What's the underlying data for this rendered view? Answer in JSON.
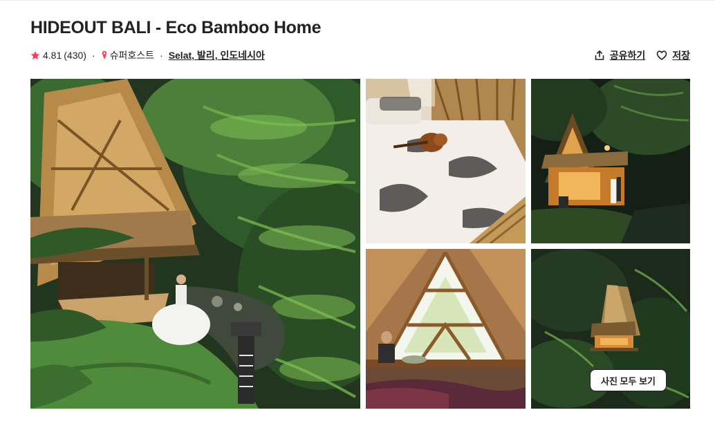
{
  "listing": {
    "title": "HIDEOUT BALI - Eco Bamboo Home",
    "rating": "4.81",
    "reviews": "(430)",
    "separator": "·",
    "host_badge": "슈퍼호스트",
    "location": "Selat, 발리, 인도네시아"
  },
  "actions": {
    "share_label": "공유하기",
    "save_label": "저장"
  },
  "gallery": {
    "photos": [
      {
        "subject": "jungle-bamboo-house-bride"
      },
      {
        "subject": "bedroom-bamboo-bed-guitar"
      },
      {
        "subject": "night-house-couple"
      },
      {
        "subject": "triangle-window-interior"
      },
      {
        "subject": "aerial-bamboo-house"
      }
    ],
    "show_all_label": "사진 모두 보기"
  },
  "colors": {
    "rating_star": "#FF385C",
    "text": "#222222",
    "border": "#EBEBEB"
  },
  "icons": {
    "rating": "star-icon",
    "superhost": "medal-icon",
    "share": "share-icon",
    "save": "heart-icon"
  }
}
